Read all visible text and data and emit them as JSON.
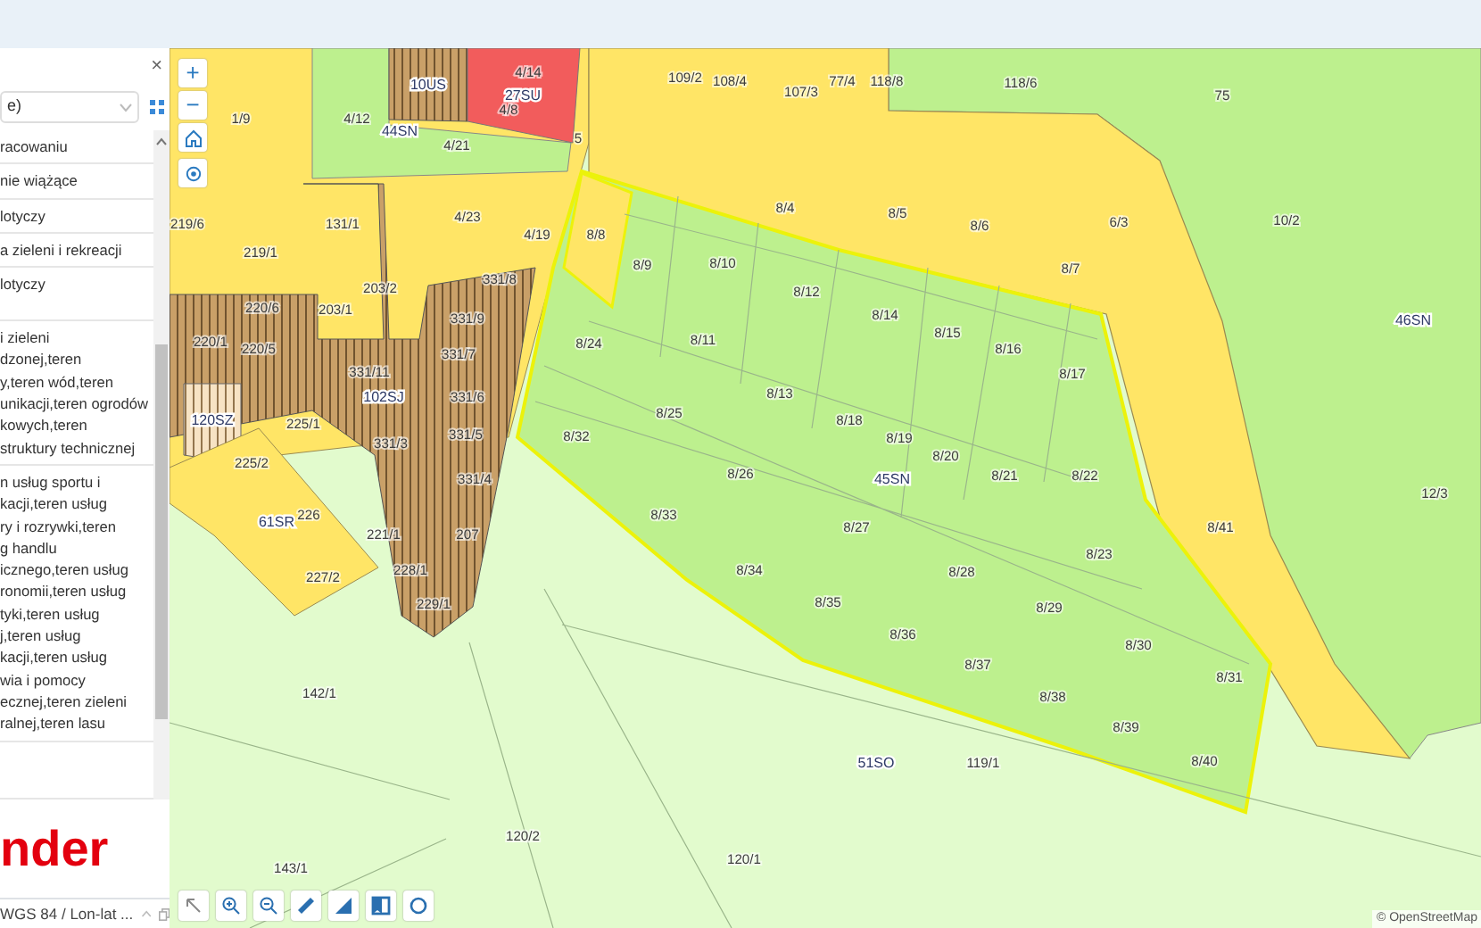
{
  "legend": {
    "close": "×",
    "select_value": "e)",
    "items": [
      {
        "lines": [
          "racowaniu"
        ]
      },
      {
        "lines": [
          "nie wiążące"
        ]
      },
      {
        "lines": [
          "lotyczy"
        ]
      },
      {
        "lines": [
          "a zieleni i rekreacji"
        ]
      },
      {
        "lines": [
          "lotyczy"
        ]
      },
      {
        "lines": [
          "i zieleni",
          "dzonej,teren",
          "y,teren wód,teren",
          "unikacji,teren ogrodów",
          "kowych,teren",
          "struktury technicznej"
        ]
      },
      {
        "lines": [
          "n usług sportu i",
          "kacji,teren usług",
          "ry i rozrywki,teren",
          "g handlu",
          "icznego,teren usług",
          "ronomii,teren usług",
          "tyki,teren usług",
          "j,teren usług",
          "kacji,teren usług",
          "wia i pomocy",
          "ecznej,teren zieleni",
          "ralnej,teren lasu"
        ]
      }
    ],
    "logo": "nder",
    "projection": "WGS 84 / Lon-lat ..."
  },
  "map": {
    "zoom_in": "+",
    "zoom_out": "−",
    "attribution": "© OpenStreetMap",
    "zone_labels": [
      "10US",
      "27SU",
      "44SN",
      "46SN",
      "102SJ",
      "120SZ",
      "45SN",
      "61SR",
      "51SO"
    ],
    "parcel_labels": [
      "4/14",
      "109/2",
      "108/4",
      "107/3",
      "77/4",
      "118/8",
      "118/6",
      "75",
      "1/9",
      "4/12",
      "4/8",
      "4/21",
      "5",
      "219/6",
      "131/1",
      "4/23",
      "4/19",
      "8/8",
      "8/4",
      "8/5",
      "8/6",
      "6/3",
      "10/2",
      "219/1",
      "8/9",
      "8/10",
      "8/7",
      "203/2",
      "331/8",
      "8/12",
      "220/6",
      "203/1",
      "331/9",
      "8/14",
      "220/1",
      "220/5",
      "331/7",
      "8/24",
      "8/11",
      "8/15",
      "8/16",
      "331/11",
      "8/17",
      "331/6",
      "8/13",
      "225/1",
      "8/25",
      "8/18",
      "331/3",
      "331/5",
      "8/32",
      "8/19",
      "225/2",
      "8/20",
      "331/4",
      "8/26",
      "8/21",
      "8/22",
      "12/3",
      "226",
      "8/33",
      "221/1",
      "207",
      "8/27",
      "8/41",
      "8/23",
      "227/2",
      "228/1",
      "8/34",
      "8/28",
      "229/1",
      "8/35",
      "8/29",
      "8/36",
      "8/30",
      "8/37",
      "8/31",
      "142/1",
      "8/38",
      "8/39",
      "119/1",
      "8/40",
      "120/2",
      "120/1",
      "143/1"
    ]
  }
}
